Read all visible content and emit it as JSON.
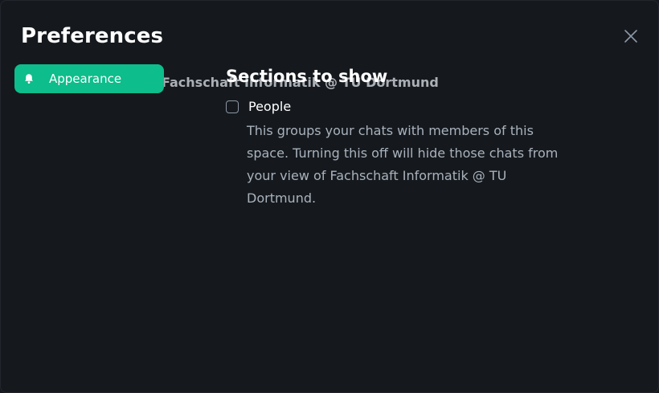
{
  "dialog": {
    "title": "Preferences",
    "close_icon": "close-icon"
  },
  "sidebar": {
    "items": [
      {
        "label": "Appearance",
        "icon": "bell-icon",
        "active": true
      }
    ]
  },
  "background_title": "Fachschaft Informatik @ TU Dortmund",
  "main": {
    "section_heading": "Sections to show",
    "options": [
      {
        "label": "People",
        "checked": false,
        "description": "This groups your chats with members of this space. Turning this off will hide those chats from your view of Fachschaft Informatik @ TU Dortmund."
      }
    ]
  },
  "colors": {
    "background": "#15191e",
    "accent": "#0dbd8b",
    "text_primary": "#ffffff",
    "text_secondary": "#a9b2bc"
  }
}
